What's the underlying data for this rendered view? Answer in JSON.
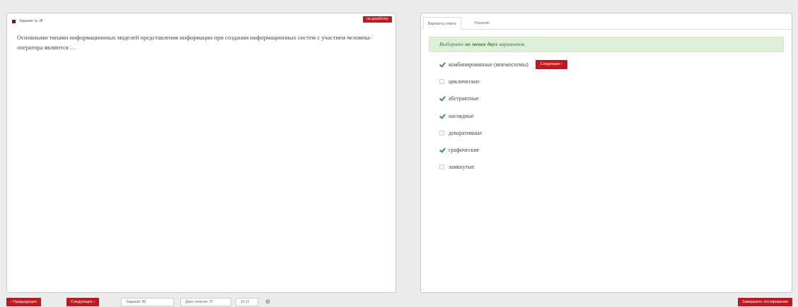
{
  "task": {
    "number_label": "Задание № 38",
    "flag_label": "на доработку",
    "question": "Основными типами информационных моделей представления информации при создании информационных систем с участием человека-оператора являются …"
  },
  "answer": {
    "tabs": [
      {
        "label": "Варианты ответа",
        "active": true
      },
      {
        "label": "Решение",
        "active": false
      }
    ],
    "hint_prefix": "Выберите ",
    "hint_emphasis": "не менее двух",
    "hint_suffix": " вариантов",
    "next_button_label": "Следующее ›",
    "options": [
      {
        "label": "комбинированные (мнемосхемы)",
        "checked": true
      },
      {
        "label": "циклические",
        "checked": false
      },
      {
        "label": "абстрактные",
        "checked": true
      },
      {
        "label": "наглядные",
        "checked": true
      },
      {
        "label": "декоративные",
        "checked": false
      },
      {
        "label": "графические",
        "checked": true
      },
      {
        "label": "замкнутые",
        "checked": false
      }
    ]
  },
  "footer": {
    "prev_label": "‹ Предыдущее",
    "next_label": "Следующее ›",
    "tasks_count": "Заданий: 86",
    "answers_count": "Дано ответов: 37",
    "timer": "16:12",
    "gear_icon": "gear-icon",
    "finish_label": "Завершить тестирование"
  },
  "colors": {
    "accent_red": "#c4161c",
    "check_green": "#3d9b35",
    "hint_bg": "#dff0d8"
  }
}
